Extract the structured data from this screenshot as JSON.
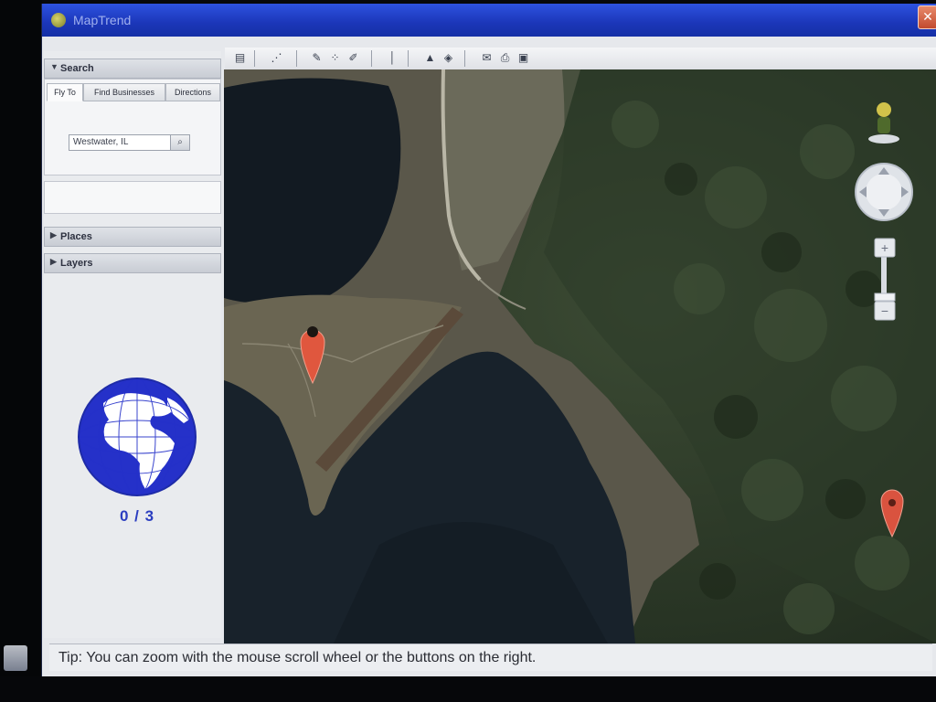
{
  "window": {
    "title": "MapTrend",
    "close_label": "✕"
  },
  "toolbar": {
    "icons": [
      "sidebar-toggle-icon",
      "route-icon",
      "draw-polygon-icon",
      "add-placemark-icon",
      "measure-icon",
      "ruler-icon",
      "terrain-view-icon",
      "hybrid-view-icon",
      "email-icon",
      "print-icon",
      "save-image-icon"
    ]
  },
  "sidebar": {
    "search_header": "Search",
    "tabs": [
      "Fly To",
      "Find Businesses",
      "Directions"
    ],
    "active_tab": "Fly To",
    "fly_to_value": "Westwater, IL",
    "places_header": "Places",
    "layers_header": "Layers"
  },
  "progress": {
    "found": 0,
    "total": 3,
    "label": "0 / 3"
  },
  "map": {
    "markers": [
      {
        "name": "placemark-1",
        "color": "#e0573e"
      },
      {
        "name": "placemark-2",
        "color": "#d9533f"
      }
    ]
  },
  "status": {
    "tip": "Tip: You can zoom with the mouse scroll wheel or the buttons on the right."
  },
  "colors": {
    "titlebar": "#1b36b8",
    "globe_blue": "#2531c9",
    "marker": "#e0573e"
  }
}
